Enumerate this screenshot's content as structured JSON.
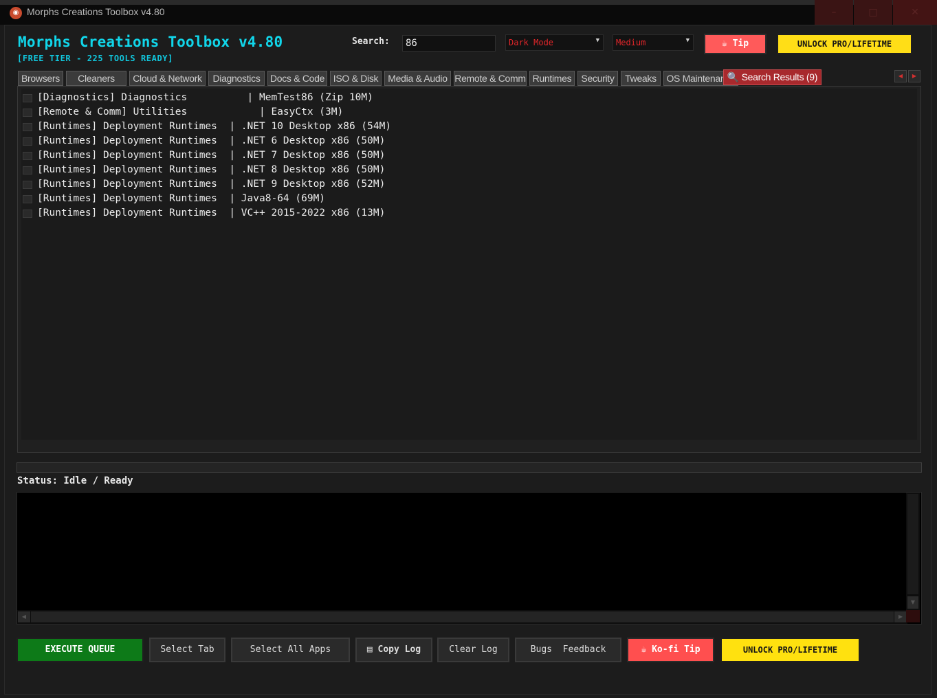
{
  "window": {
    "title": "Morphs Creations Toolbox v4.80",
    "min_glyph": "–",
    "max_glyph": "□",
    "close_glyph": "✕"
  },
  "header": {
    "title": "Morphs Creations Toolbox v4.80",
    "tier": "[FREE TIER - 225 TOOLS READY]",
    "search_label": "Search:",
    "search_value": "86",
    "theme": "Dark Mode",
    "size": "Medium",
    "tip_label": "Tip",
    "unlock_label": "UNLOCK PRO/LIFETIME"
  },
  "tabs": [
    {
      "label": "Browsers"
    },
    {
      "label": "Cleaners"
    },
    {
      "label": "Cloud & Network"
    },
    {
      "label": "Diagnostics"
    },
    {
      "label": "Docs & Code"
    },
    {
      "label": "ISO & Disk"
    },
    {
      "label": "Media & Audio"
    },
    {
      "label": "Remote & Comm"
    },
    {
      "label": "Runtimes"
    },
    {
      "label": "Security"
    },
    {
      "label": "Tweaks"
    },
    {
      "label": "OS Maintenance"
    },
    {
      "label": "Search Results (9)"
    }
  ],
  "results": [
    {
      "text": "[Diagnostics] Diagnostics          | MemTest86 (Zip 10M)"
    },
    {
      "text": "[Remote & Comm] Utilities            | EasyCtx (3M)"
    },
    {
      "text": "[Runtimes] Deployment Runtimes  | .NET 10 Desktop x86 (54M)"
    },
    {
      "text": "[Runtimes] Deployment Runtimes  | .NET 6 Desktop x86 (50M)"
    },
    {
      "text": "[Runtimes] Deployment Runtimes  | .NET 7 Desktop x86 (50M)"
    },
    {
      "text": "[Runtimes] Deployment Runtimes  | .NET 8 Desktop x86 (50M)"
    },
    {
      "text": "[Runtimes] Deployment Runtimes  | .NET 9 Desktop x86 (52M)"
    },
    {
      "text": "[Runtimes] Deployment Runtimes  | Java8-64 (69M)"
    },
    {
      "text": "[Runtimes] Deployment Runtimes  | VC++ 2015-2022 x86 (13M)"
    }
  ],
  "status": "Status: Idle / Ready",
  "buttons": {
    "execute": "EXECUTE QUEUE",
    "select_tab": "Select Tab",
    "select_all": "Select All Apps",
    "copy_log": "Copy Log",
    "clear_log": "Clear Log",
    "bugs": "Bugs  Feedback",
    "kofi": "Ko-fi Tip",
    "unlock": "UNLOCK PRO/LIFETIME"
  },
  "colors": {
    "accent_cyan": "#11d6ea",
    "active_tab": "#a8292d",
    "execute_green": "#0d7a18",
    "tip_red": "#ff5a5a",
    "unlock_yellow": "#ffde17"
  }
}
